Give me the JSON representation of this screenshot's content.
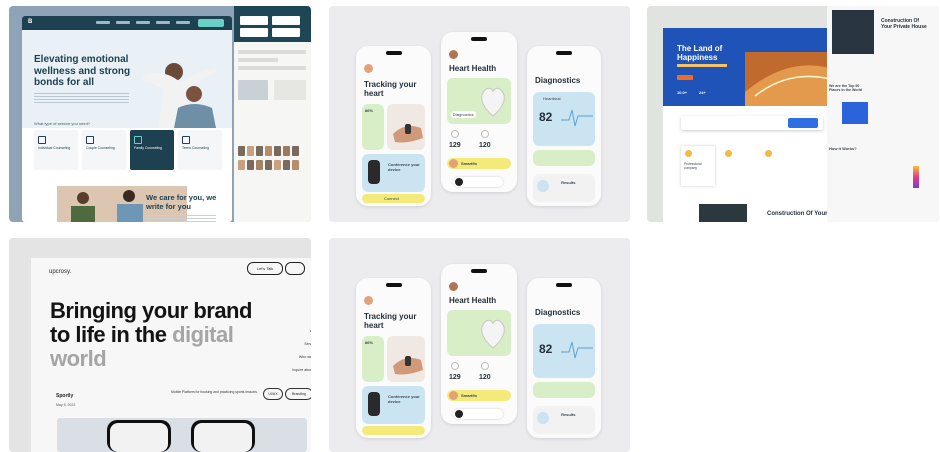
{
  "tiles": {
    "t1": {
      "logo": "B",
      "hero_title": "Elevating emotional wellness and strong bonds for all",
      "question": "What type of service you need?",
      "cards": [
        {
          "title": "Individual Counseling"
        },
        {
          "title": "Couple Counseling"
        },
        {
          "title": "Family Counseling"
        },
        {
          "title": "Teens Counseling"
        }
      ],
      "section_title": "We care for you, we write for you"
    },
    "t2": {
      "screen1_title": "Tracking your heart",
      "screen1_percent": "86%",
      "screen1_card": "Conference your device",
      "screen1_button": "Connect",
      "screen2_title": "Heart Health",
      "screen2_chip": "Diagnostics",
      "screen2_value": "129",
      "screen2_value2": "120",
      "screen2_name": "Smartfix",
      "screen3_title": "Diagnostics",
      "screen3_label": "Heartbeat",
      "screen3_value": "82",
      "screen3_results": "Results"
    },
    "t3": {
      "hero_title": "The Land of Happiness",
      "stats": [
        "10.0+",
        "24+"
      ],
      "feature_card": "Professional company",
      "construction_title": "Construction Of Your",
      "right_title": "Construction Of Your Private House",
      "right_sub": "We are the Top 50 Places in the World",
      "right_section": "How it Works?"
    },
    "t4": {
      "brand": "upcrosy.",
      "lets_talk": "Let's Talk",
      "headline_dark": "Bringing your brand to life in the",
      "headline_gray": "digital world",
      "links": [
        "Work",
        "Services",
        "Who we are",
        "Inquire about us"
      ],
      "project_title": "Sportly",
      "project_date": "May 5, 2022",
      "description": "Mobile Platform for booking and practicing sports lessons.",
      "tags": [
        "UI/UX",
        "Branding"
      ]
    },
    "t5": {
      "screen1_title": "Tracking your heart",
      "screen1_percent": "86%",
      "screen1_card": "Conference your device",
      "screen2_title": "Heart Health",
      "screen2_value": "129",
      "screen2_value2": "120",
      "screen2_name": "Smartfix",
      "screen3_title": "Diagnostics",
      "screen3_value": "82",
      "screen3_results": "Results"
    }
  },
  "colors": {
    "t1_bg": "#8ea3b7",
    "t1_dark": "#1d4150",
    "t1_accent": "#6ad0c6",
    "phone_green": "#d8eec6",
    "phone_yellow": "#f4ea7a",
    "phone_blue": "#cbe4f2",
    "t3_blue": "#1f53b8",
    "t3_orange": "#f26b21"
  }
}
